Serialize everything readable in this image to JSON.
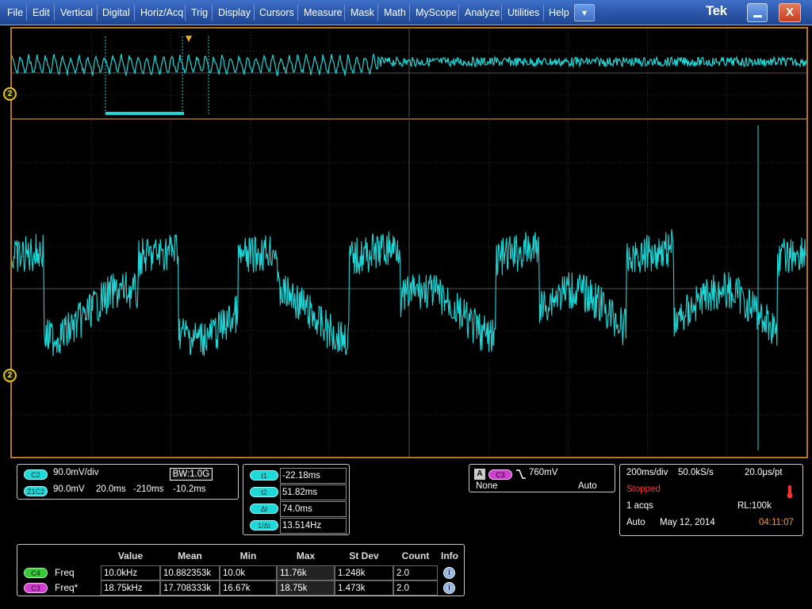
{
  "menu": {
    "items": [
      "File",
      "Edit",
      "Vertical",
      "Digital",
      "Horiz/Acq",
      "Trig",
      "Display",
      "Cursors",
      "Measure",
      "Mask",
      "Math",
      "MyScope",
      "Analyze",
      "Utilities",
      "Help"
    ],
    "dropdown_icon": "▾",
    "logo": "Tek",
    "minimize_icon": "minimize-icon",
    "close_label": "X"
  },
  "screen": {
    "colors": {
      "trace": "#1fd6d6",
      "grid": "#555555",
      "border": "#b87818",
      "marker": "#e8c020"
    },
    "channel_marker_upper": "2",
    "channel_marker_lower": "2"
  },
  "channel_panel": {
    "c2_badge": "C2",
    "c2_scale": "90.0mV/div",
    "bandwidth_label": "BW:1.0G",
    "zoom_badge": "Z1C2",
    "zoom_scale": "90.0mV",
    "zoom_time": "20.0ms",
    "zoom_position": "-210ms",
    "zoom_offset": "-10.2ms"
  },
  "cursors": {
    "rows": [
      {
        "label": "t1",
        "value": "-22.18ms"
      },
      {
        "label": "t2",
        "value": "51.82ms"
      },
      {
        "label": "Δt",
        "value": "74.0ms"
      },
      {
        "label": "1/Δt",
        "value": "13.514Hz"
      }
    ]
  },
  "trigger": {
    "mode_letter": "A",
    "source_badge": "C3",
    "slope_icon": "falling-edge-icon",
    "level": "760mV",
    "coupling": "None",
    "trigger_mode": "Auto"
  },
  "acquisition": {
    "horiz_scale": "200ms/div",
    "sample_rate": "50.0kS/s",
    "resolution": "20.0μs/pt",
    "state": "Stopped",
    "acqs": "1 acqs",
    "record_length": "RL:100k",
    "mode": "Auto",
    "date": "May 12, 2014",
    "time": "04:11:07",
    "state_color": "#ff3030",
    "time_color": "#ff9a20"
  },
  "measurements": {
    "headers": [
      "Value",
      "Mean",
      "Min",
      "Max",
      "St Dev",
      "Count",
      "Info"
    ],
    "rows": [
      {
        "badge": "C4",
        "name": "Freq",
        "value": "10.0kHz",
        "mean": "10.882353k",
        "min": "10.0k",
        "max": "11.76k",
        "stdev": "1.248k",
        "count": "2.0"
      },
      {
        "badge": "C3",
        "name": "Freq*",
        "value": "18.75kHz",
        "mean": "17.708333k",
        "min": "16.67k",
        "max": "18.75k",
        "stdev": "1.473k",
        "count": "2.0"
      }
    ]
  }
}
